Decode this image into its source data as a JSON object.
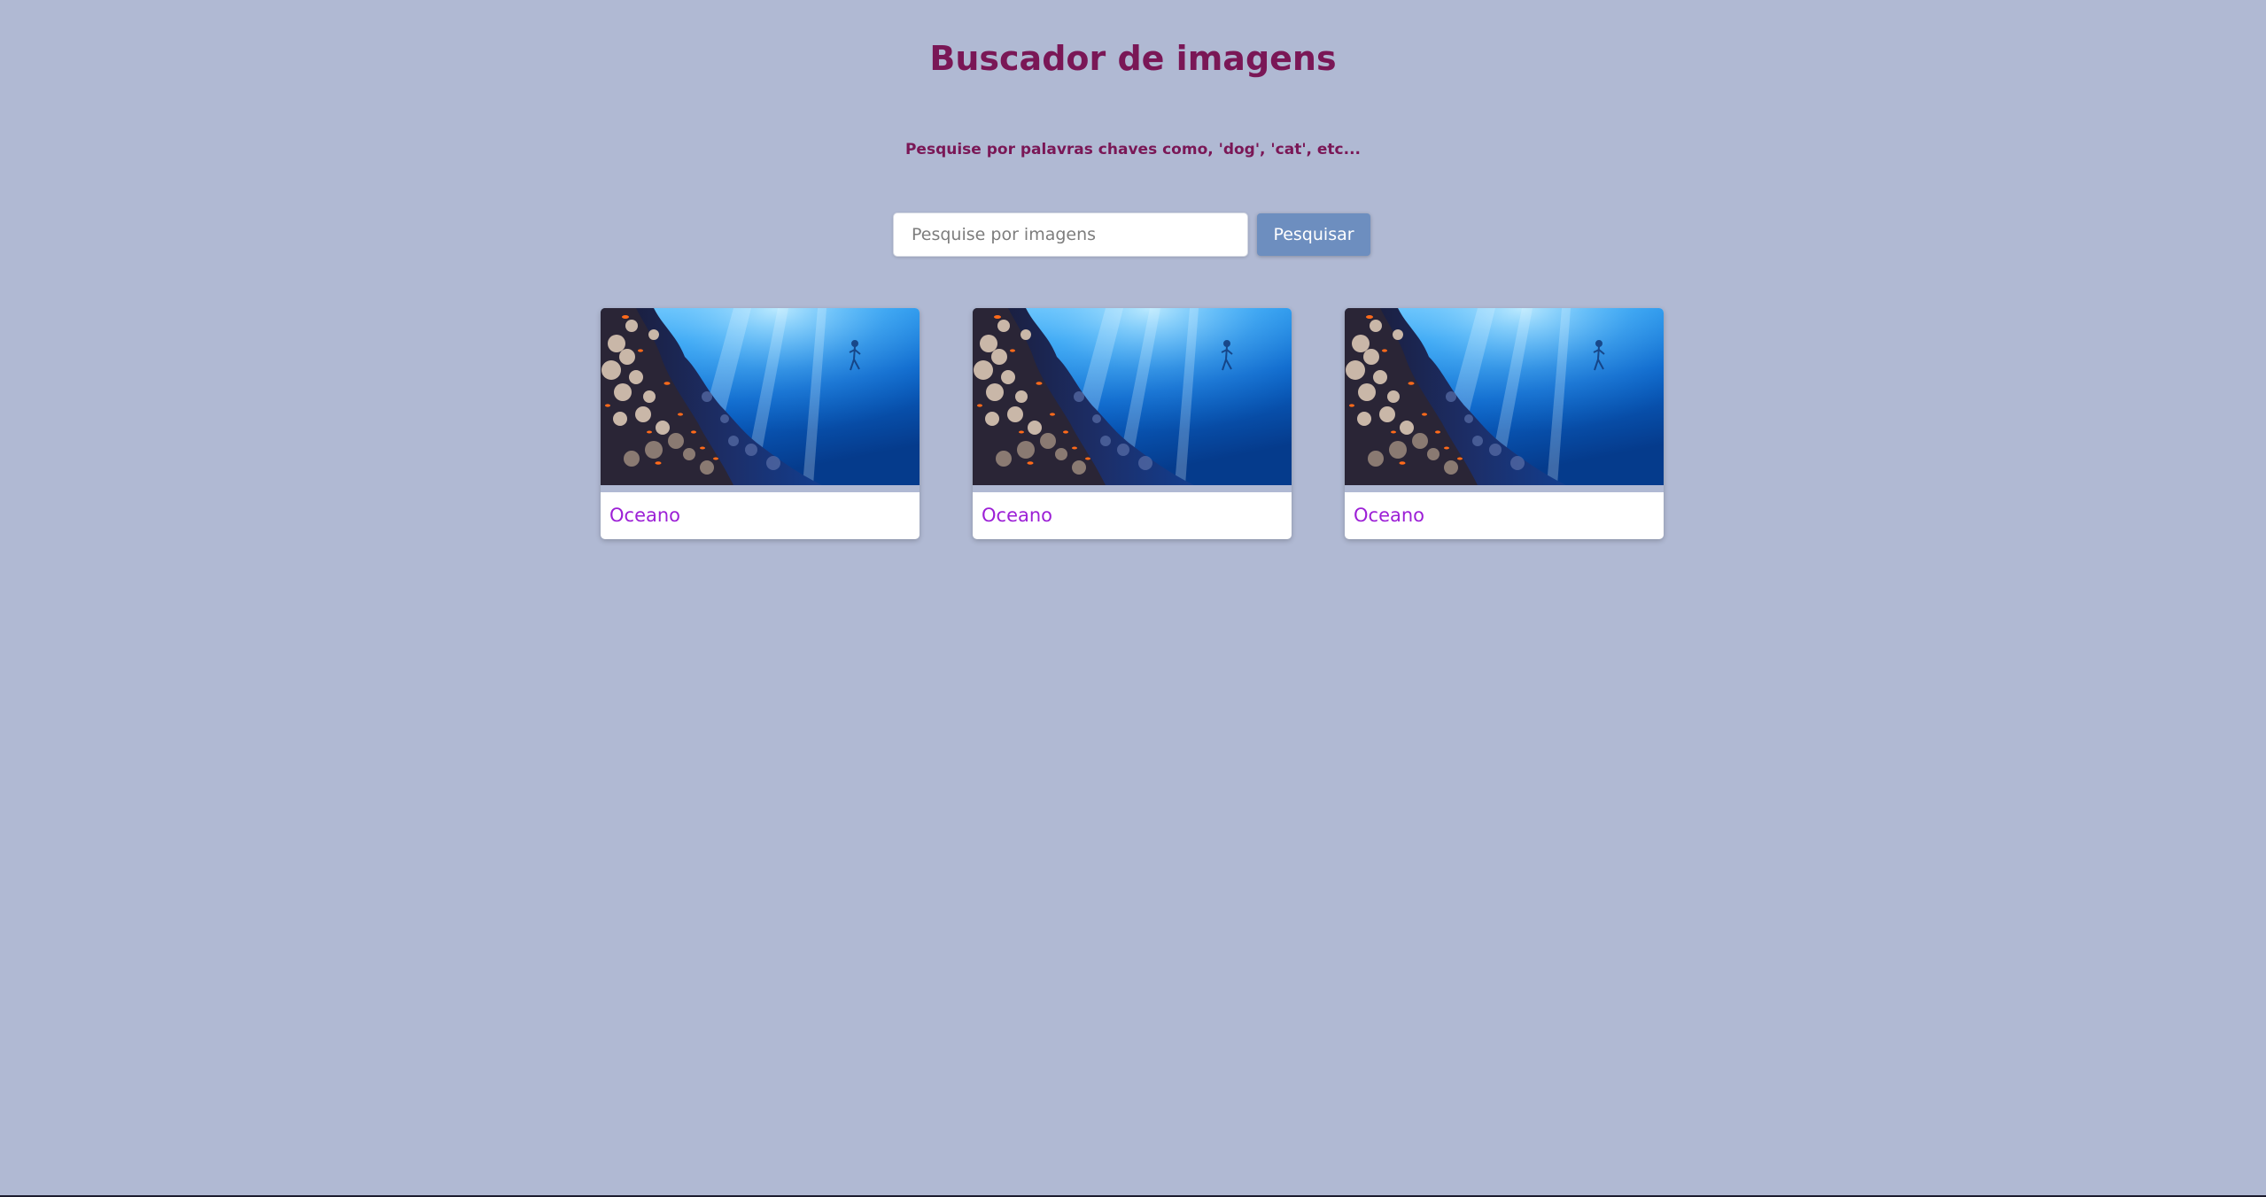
{
  "header": {
    "title": "Buscador de imagens",
    "subtitle": "Pesquise por palavras chaves como, 'dog', 'cat', etc..."
  },
  "search": {
    "placeholder": "Pesquise por imagens",
    "value": "",
    "button_label": "Pesquisar"
  },
  "results": [
    {
      "caption": "Oceano",
      "image": "ocean-coral-reef-photo"
    },
    {
      "caption": "Oceano",
      "image": "ocean-coral-reef-photo"
    },
    {
      "caption": "Oceano",
      "image": "ocean-coral-reef-photo"
    }
  ],
  "colors": {
    "background": "#b0b9d3",
    "title": "#7a1756",
    "button": "#6d8ebf",
    "link": "#9c1fd6"
  }
}
